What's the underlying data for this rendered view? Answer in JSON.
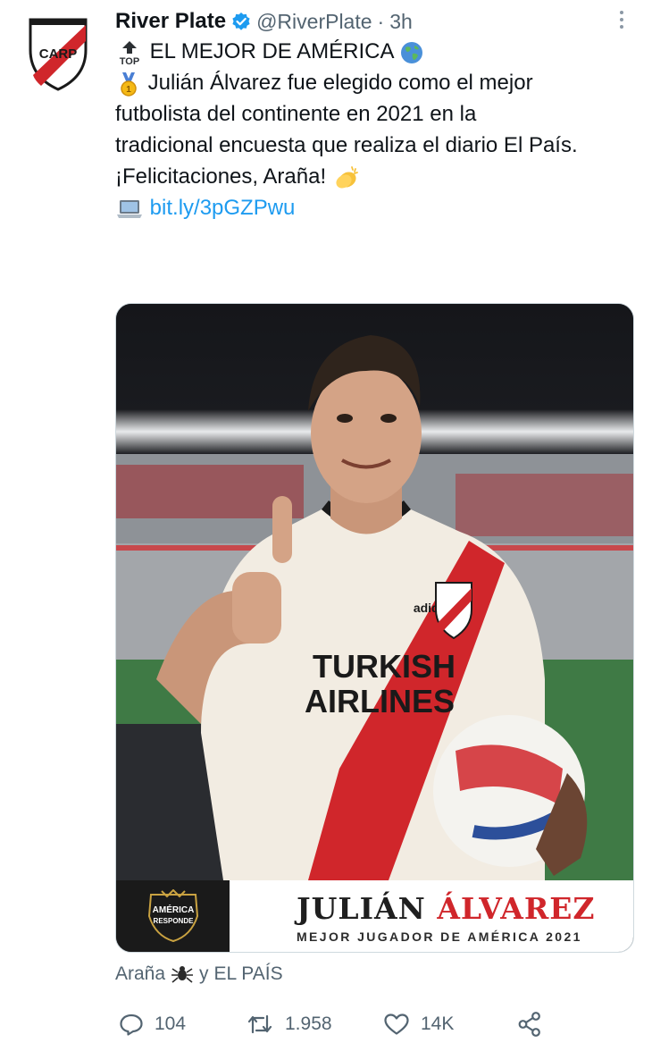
{
  "tweet": {
    "author_name": "River Plate",
    "author_handle": "@RiverPlate",
    "separator": "·",
    "time": "3h",
    "line1": "EL MEJOR DE AMÉRICA",
    "body_line1": "Julián Álvarez fue elegido como el mejor",
    "body_line2": "futbolista del continente en 2021 en la",
    "body_line3": "tradicional encuesta que realiza el diario El País.",
    "body_line4": "¡Felicitaciones, Araña!",
    "link": "bit.ly/3pGZPwu",
    "badge_logo_text": "CARP"
  },
  "media": {
    "banner_first_name": "JULIÁN",
    "banner_last_name": "ÁLVAREZ",
    "banner_subtitle": "MEJOR JUGADOR DE AMÉRICA 2021",
    "banner_logo_line1": "AMÉRICA",
    "banner_logo_line2": "RESPONDE",
    "shirt_sponsor_line1": "TURKISH",
    "shirt_sponsor_line2": "AIRLINES",
    "shirt_brand": "adidas"
  },
  "tags": {
    "tag1": "Araña",
    "connector": "y",
    "tag2": "EL PAÍS"
  },
  "actions": {
    "replies": "104",
    "retweets": "1.958",
    "likes": "14K"
  },
  "colors": {
    "link": "#1d9bf0",
    "muted": "#536471",
    "river_red": "#d0262b"
  }
}
